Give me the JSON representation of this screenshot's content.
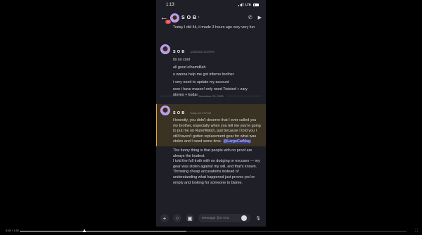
{
  "status": {
    "time": "1:13",
    "network": "LTE"
  },
  "header": {
    "back_badge": "10",
    "contact_name": "S O B",
    "chevron": "›"
  },
  "messages": {
    "top_partial": "Today I did 4k, it made 3 hours ago very very fun",
    "group1": {
      "username": "S O B",
      "timestamp": "12/15/2025 12:39 PM",
      "lines": [
        "its so cool",
        "all good elhamdllah",
        "u wanna help me got inferno brother",
        "i very need to update my account",
        "now i have mason! only need Twisted + zary gloves + kodar"
      ]
    },
    "date_divider": "December 20, 2025",
    "group2": {
      "username": "S O B",
      "timestamp": "Today at 12:37 AM",
      "highlighted_text": "Honestly, you didn't deserve that I ever called you my brother, especially when you tell me you're going to put me on RuneWatch, just because I told you I still haven't gotten replacement gear for what was stolen and I need some time.",
      "mention": "@LargoCarMag",
      "paragraphs": [
        "The funny thing is that people with no proof are always the loudest.",
        "I told the full truth with no dodging or excuses — my gear was stolen against my will, and that's known.",
        "Throwing cheap accusations instead of understanding what happened just proves you're empty and looking for someone to blame."
      ]
    }
  },
  "composer": {
    "placeholder": "Message @S O B"
  },
  "video": {
    "time_label": "0:49 / 1:52",
    "progress": 0.43
  },
  "colors": {
    "background": "#1f1f27",
    "accent_mention": "#3b3f8e",
    "highlight": "#3a3222",
    "highlight_border": "#e0a83a"
  }
}
